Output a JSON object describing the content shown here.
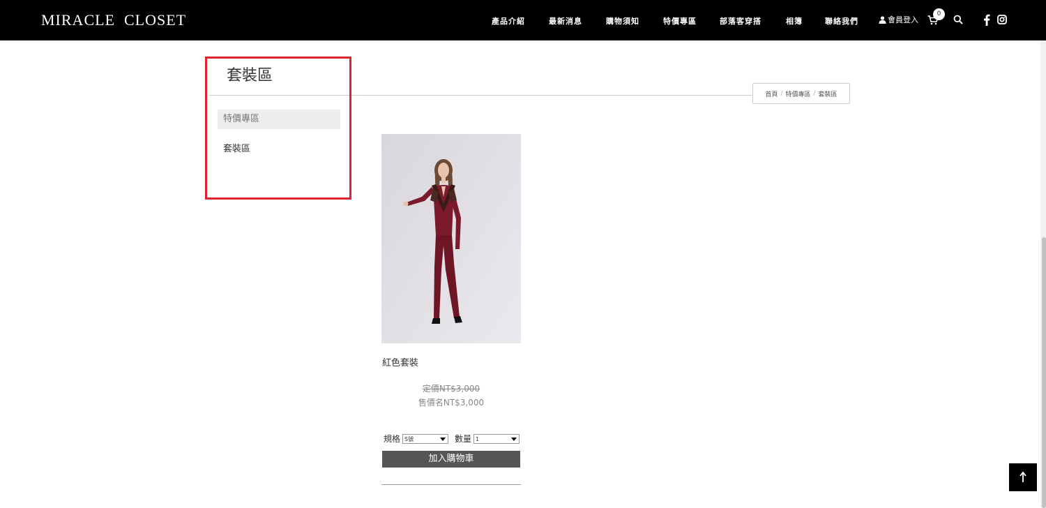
{
  "header": {
    "logo": "MIRACLE  CLOSET",
    "nav": [
      "產品介紹",
      "最新消息",
      "購物須知",
      "特價專區",
      "部落客穿搭",
      "相簿",
      "聯絡我們"
    ],
    "member_login": "會員登入",
    "cart_count": "0"
  },
  "page": {
    "title": "套裝區",
    "breadcrumb": [
      "首頁",
      "特價專區",
      "套裝區"
    ]
  },
  "sidebar": {
    "items": [
      {
        "label": "特價專區",
        "active": true
      },
      {
        "label": "套裝區",
        "active": false
      }
    ]
  },
  "product": {
    "name": "紅色套裝",
    "list_price_label": "定價",
    "list_price": "NT$3,000",
    "sale_price_label": "售價名",
    "sale_price": "NT$3,000",
    "spec_label": "規格",
    "spec_value": "S號",
    "qty_label": "數量",
    "qty_value": "1",
    "add_to_cart": "加入購物車"
  },
  "colors": {
    "header_bg": "#000000",
    "highlight_border": "#e0232e",
    "button_bg": "#555555",
    "outfit": "#7a1a2a"
  }
}
